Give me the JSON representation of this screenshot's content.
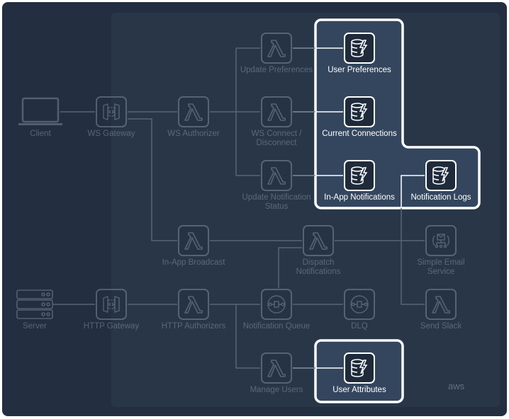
{
  "colors": {
    "background": "#232f40",
    "panel": "#283648",
    "highlight": "#34465e",
    "highlight_border": "#ffffff"
  },
  "nodes": {
    "client": "Client",
    "ws_gateway": "WS Gateway",
    "ws_authorizer": "WS Authorizer",
    "update_preferences": "Update Preferences",
    "ws_connect": "WS Connect /\nDisconnect",
    "update_notification_status": "Update Notification\nStatus",
    "user_preferences": "User Preferences",
    "current_connections": "Current Connections",
    "in_app_notifications": "In-App Notifications",
    "notification_logs": "Notification Logs",
    "in_app_broadcast": "In-App Broadcast",
    "dispatch_notifications": "Dispatch\nNotifications",
    "simple_email_service": "Simple Email\nService",
    "server": "Server",
    "http_gateway": "HTTP Gateway",
    "http_authorizers": "HTTP Authorizers",
    "notification_queue": "Notification Queue",
    "dlq": "DLQ",
    "send_slack": "Send Slack",
    "manage_users": "Manage Users",
    "user_attributes": "User Attributes"
  },
  "logo": "aws"
}
